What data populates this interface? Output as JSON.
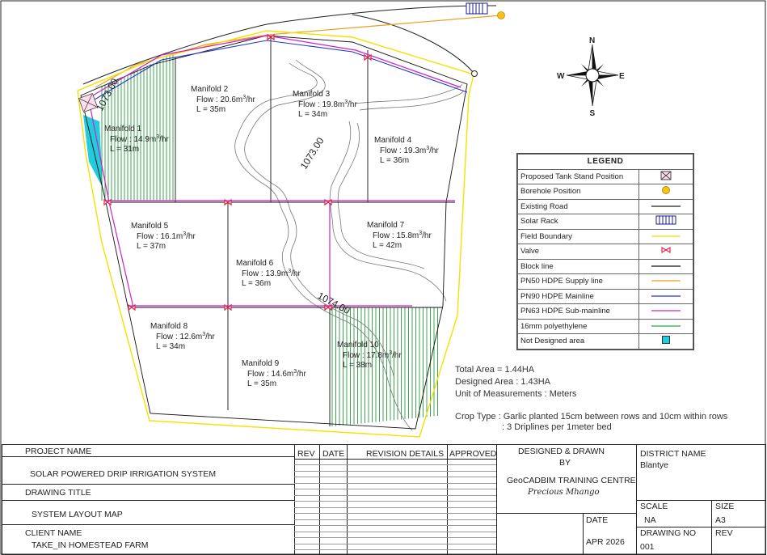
{
  "manifolds": [
    {
      "name": "Manifold  1",
      "flow": "Flow : 14.9m",
      "unit": "3",
      "tail": "/hr",
      "len": "L = 31m"
    },
    {
      "name": "Manifold  2",
      "flow": "Flow : 20.6m",
      "unit": "3",
      "tail": "/hr",
      "len": "L = 35m"
    },
    {
      "name": "Manifold  3",
      "flow": "Flow : 19.8m",
      "unit": "3",
      "tail": "/hr",
      "len": "L = 34m"
    },
    {
      "name": "Manifold  4",
      "flow": "Flow : 19.3m",
      "unit": "3",
      "tail": "/hr",
      "len": "L = 36m"
    },
    {
      "name": "Manifold  5",
      "flow": "Flow : 16.1m",
      "unit": "3",
      "tail": "/hr",
      "len": "L = 37m"
    },
    {
      "name": "Manifold  6",
      "flow": "Flow : 13.9m",
      "unit": "3",
      "tail": "/hr",
      "len": "L = 36m"
    },
    {
      "name": "Manifold  7",
      "flow": "Flow : 15.8m",
      "unit": "3",
      "tail": "/hr",
      "len": "L = 42m"
    },
    {
      "name": "Manifold  8",
      "flow": "Flow : 12.6m",
      "unit": "3",
      "tail": "/hr",
      "len": "L = 34m"
    },
    {
      "name": "Manifold  9",
      "flow": "Flow : 14.6m",
      "unit": "3",
      "tail": "/hr",
      "len": "L = 35m"
    },
    {
      "name": "Manifold  10",
      "flow": "Flow : 17.8m",
      "unit": "3",
      "tail": "/hr",
      "len": "L = 38m"
    }
  ],
  "contours": [
    "1073.00",
    "1073.00",
    "1074.00"
  ],
  "compass": {
    "n": "N",
    "s": "S",
    "e": "E",
    "w": "W"
  },
  "legend": {
    "title": "LEGEND",
    "items": [
      {
        "label": "Proposed Tank Stand Position",
        "symbol": "tank-icon"
      },
      {
        "label": "Borehole Position",
        "symbol": "borehole-icon"
      },
      {
        "label": "Existing Road",
        "symbol": "road-line",
        "color": "#222222"
      },
      {
        "label": "Solar Rack",
        "symbol": "solar-rack-icon",
        "color": "#1a1a8c"
      },
      {
        "label": "Field Boundary",
        "symbol": "boundary-line",
        "color": "#f2e200"
      },
      {
        "label": "Valve",
        "symbol": "valve-icon",
        "color": "#e0204a"
      },
      {
        "label": "Block line",
        "symbol": "block-line",
        "color": "#111111"
      },
      {
        "label": "PN50 HDPE Supply line",
        "symbol": "supply-line",
        "color": "#e8a020"
      },
      {
        "label": "PN90 HDPE Mainline",
        "symbol": "mainline",
        "color": "#2233cc"
      },
      {
        "label": "PN63 HDPE  Sub-mainline",
        "symbol": "submain-line",
        "color": "#cc22cc"
      },
      {
        "label": "16mm polyethylene",
        "symbol": "poly-line",
        "color": "#22aa44"
      },
      {
        "label": "Not Designed area",
        "symbol": "not-designed-icon",
        "color": "#22ccdd"
      }
    ]
  },
  "summary": {
    "total_area": "Total Area = 1.44HA",
    "designed_area": "Designed Area : 1.43HA",
    "units": "Unit of Measurements : Meters",
    "crop_1": "Crop Type : Garlic planted 15cm between rows and 10cm within rows",
    "crop_2": ": 3 Driplines per 1meter bed"
  },
  "title_block": {
    "project_name_label": "PROJECT NAME",
    "project_name": "SOLAR POWERED DRIP IRRIGATION SYSTEM",
    "drawing_title_label": "DRAWING TITLE",
    "drawing_title": "SYSTEM LAYOUT MAP",
    "client_label": "CLIENT NAME",
    "client": "TAKE_IN HOMESTEAD FARM",
    "rev_header": "REV",
    "date_header": "DATE",
    "revision_details_header": "REVISION DETAILS",
    "approved_header": "APPROVED",
    "designed_label": "DESIGNED & DRAWN",
    "by_label": "BY",
    "designer": "GeoCADBIM TRAINING CENTRE",
    "signature": "Precious  Mhango",
    "date_label": "DATE",
    "date_value": "APR 2026",
    "district_label": "DISTRICT  NAME",
    "district": "Blantye",
    "scale_label": "SCALE",
    "scale": "NA",
    "size_label": "SIZE",
    "size": "A3",
    "drawing_no_label": "DRAWING NO",
    "drawing_no": "001",
    "rev_label": "REV"
  }
}
